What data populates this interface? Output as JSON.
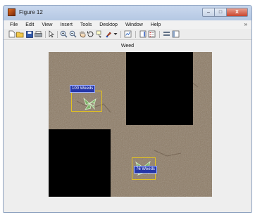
{
  "window": {
    "title": "Figure 12"
  },
  "title_buttons": {
    "minimize": "–",
    "maximize": "□",
    "close": "X"
  },
  "menu": [
    "File",
    "Edit",
    "View",
    "Insert",
    "Tools",
    "Desktop",
    "Window",
    "Help"
  ],
  "menu_overflow": "»",
  "toolbar_icons": [
    "new-figure-icon",
    "open-file-icon",
    "save-icon",
    "print-icon",
    "pointer-arrow-icon",
    "zoom-in-icon",
    "zoom-out-icon",
    "pan-hand-icon",
    "rotate-3d-icon",
    "data-cursor-icon",
    "brush-icon",
    "brush-dropdown-icon",
    "link-plot-icon",
    "insert-colorbar-icon",
    "insert-legend-icon",
    "hide-plot-tools-icon",
    "show-plot-tools-icon"
  ],
  "axes": {
    "title": "Weed"
  },
  "detections": [
    {
      "label": "100 Weeds"
    },
    {
      "label": "76 Weeds"
    }
  ],
  "colors": {
    "bbox": "#e3c21f",
    "label_bg": "#2536a8",
    "mask": "#000000"
  }
}
